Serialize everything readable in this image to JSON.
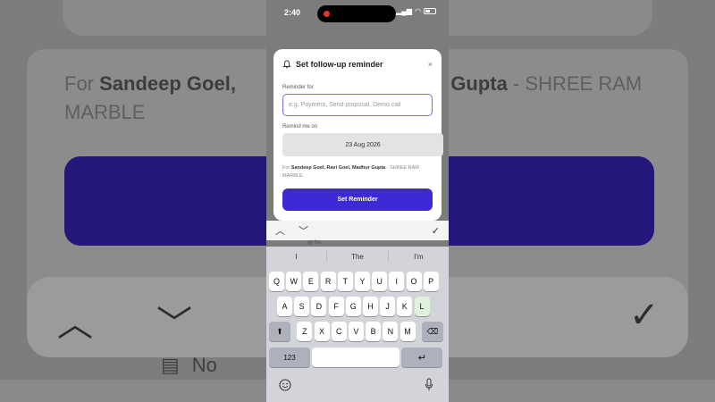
{
  "status_bar": {
    "time": "2:40"
  },
  "background": {
    "for_prefix": "For",
    "names": "Sandeep Goel, ",
    "names_tail": "ur Gupta",
    "company": " - SHREE RAM MARBLE",
    "row_label": "No"
  },
  "dialog": {
    "title": "Set follow-up reminder",
    "close_glyph": "×",
    "reminder_label": "Reminder for",
    "reminder_placeholder": "e.g. Payment, Send proposal, Demo call",
    "reminder_value": "",
    "remind_on_label": "Remind me on",
    "date_value": "23 Aug 2026",
    "for_prefix": "For ",
    "for_names": "Sandeep Goel, Ravi Goel, Madhur Gupta",
    "for_company": " - SHREE RAM MARBLE",
    "submit_label": "Set Reminder"
  },
  "accessory_bar": {
    "up_glyph": "︿",
    "down_glyph": "﹀",
    "done_glyph": "✓"
  },
  "behind_row": {
    "label": "No"
  },
  "keyboard": {
    "suggestions": [
      "I",
      "The",
      "I'm"
    ],
    "row1": [
      "Q",
      "W",
      "E",
      "R",
      "T",
      "Y",
      "U",
      "I",
      "O",
      "P"
    ],
    "row2": [
      "A",
      "S",
      "D",
      "F",
      "G",
      "H",
      "J",
      "K",
      "L"
    ],
    "row3": [
      "Z",
      "X",
      "C",
      "V",
      "B",
      "N",
      "M"
    ],
    "shift_glyph": "⬆",
    "delete_glyph": "⌫",
    "numbers_label": "123",
    "return_glyph": "↵"
  },
  "colors": {
    "accent": "#3d2ad6",
    "input_border": "#7b6fd6",
    "highlight_key": "#dff2dd"
  }
}
